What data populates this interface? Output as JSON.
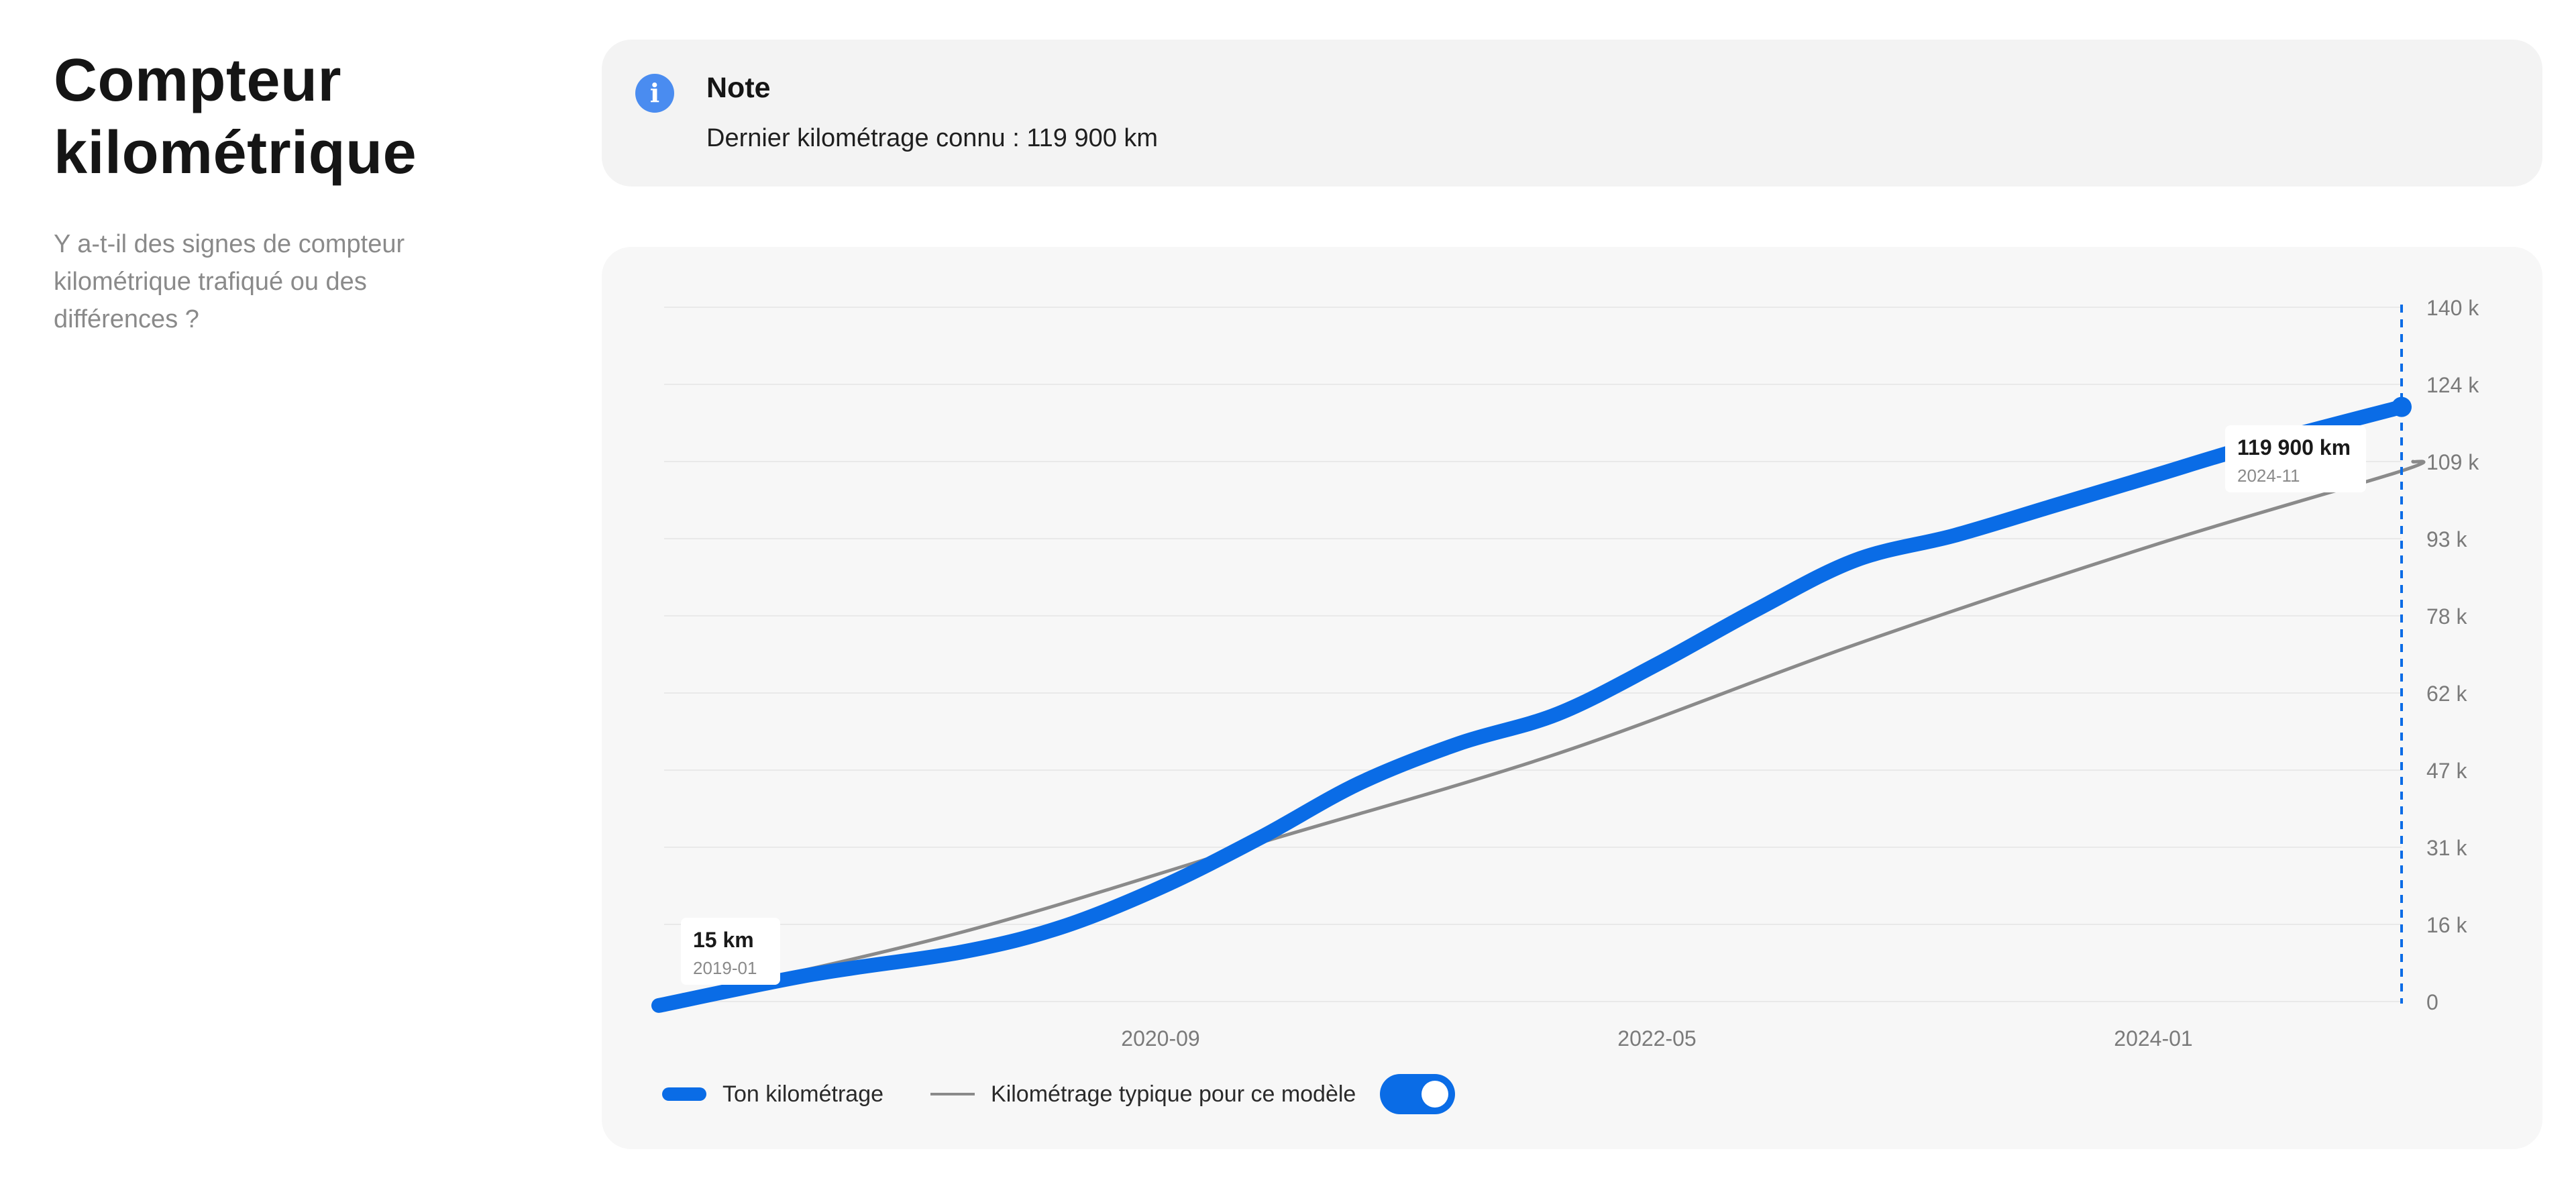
{
  "section": {
    "title_line1": "Compteur",
    "title_line2": "kilométrique",
    "subtitle": "Y a-t-il des signes de compteur kilométrique trafiqué ou des différences ?"
  },
  "note": {
    "icon": "info-icon",
    "title": "Note",
    "text": "Dernier kilométrage connu : 119 900 km"
  },
  "colors": {
    "accent": "#0a6ce6",
    "typical": "#8a8a8a",
    "note_bg": "#f3f3f3",
    "card_bg": "#f7f7f7"
  },
  "chart_data": {
    "type": "line",
    "x_ticks": [
      "2020-09",
      "2022-05",
      "2024-01"
    ],
    "y_ticks": [
      "0",
      "16 k",
      "31 k",
      "47 k",
      "62 k",
      "78 k",
      "93 k",
      "109 k",
      "124 k",
      "140 k"
    ],
    "y_tick_values": [
      0,
      15556,
      31111,
      46667,
      62222,
      77778,
      93333,
      108889,
      124444,
      140000
    ],
    "ylim": [
      0,
      140000
    ],
    "xlim": [
      "2019-01",
      "2024-11"
    ],
    "y_axis_position": "right",
    "grid": true,
    "series": [
      {
        "name": "Ton kilométrage",
        "color": "#0a6ce6",
        "points": [
          [
            "2019-01",
            15
          ],
          [
            "2019-07",
            5500
          ],
          [
            "2020-01",
            10000
          ],
          [
            "2020-05",
            15000
          ],
          [
            "2020-09",
            23000
          ],
          [
            "2021-01",
            33000
          ],
          [
            "2021-05",
            44000
          ],
          [
            "2021-09",
            52000
          ],
          [
            "2022-01",
            58000
          ],
          [
            "2022-05",
            68000
          ],
          [
            "2022-09",
            79000
          ],
          [
            "2023-01",
            89000
          ],
          [
            "2023-05",
            94000
          ],
          [
            "2023-09",
            100000
          ],
          [
            "2024-01",
            106000
          ],
          [
            "2024-05",
            112000
          ],
          [
            "2024-11",
            119900
          ]
        ]
      },
      {
        "name": "Kilométrage typique pour ce modèle",
        "color": "#8a8a8a",
        "points": [
          [
            "2019-01",
            0
          ],
          [
            "2020-01",
            14000
          ],
          [
            "2021-01",
            32000
          ],
          [
            "2022-01",
            50000
          ],
          [
            "2023-01",
            72000
          ],
          [
            "2024-01",
            92000
          ],
          [
            "2024-11",
            107000
          ]
        ]
      }
    ],
    "annotations": [
      {
        "value": "15 km",
        "date": "2019-01"
      },
      {
        "value": "119 900 km",
        "date": "2024-11"
      }
    ],
    "marker_date": "2024-11",
    "legend": [
      "Ton kilométrage",
      "Kilométrage typique pour ce modèle"
    ],
    "legend_placement": "bottom-left",
    "typical_toggle_on": true
  }
}
